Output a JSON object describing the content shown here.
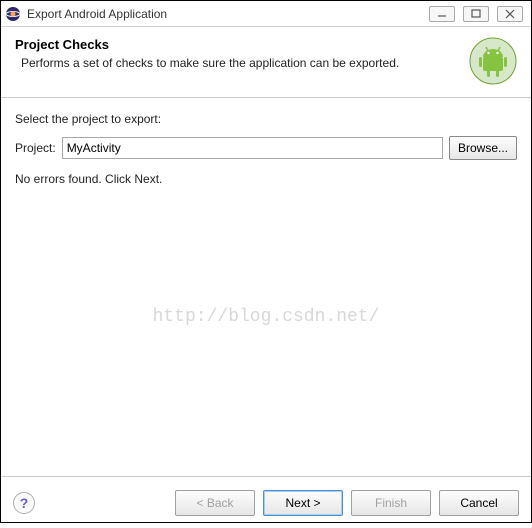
{
  "window": {
    "title": "Export Android Application"
  },
  "banner": {
    "title": "Project Checks",
    "description": "Performs a set of checks to make sure the application can be exported."
  },
  "content": {
    "select_label": "Select the project to export:",
    "project_label": "Project:",
    "project_value": "MyActivity",
    "browse_label": "Browse...",
    "status_text": "No errors found. Click Next."
  },
  "footer": {
    "back_label": "< Back",
    "next_label": "Next >",
    "finish_label": "Finish",
    "cancel_label": "Cancel"
  },
  "watermark": "http://blog.csdn.net/",
  "icons": {
    "eclipse": "eclipse-icon",
    "android": "android-icon",
    "help": "?"
  }
}
